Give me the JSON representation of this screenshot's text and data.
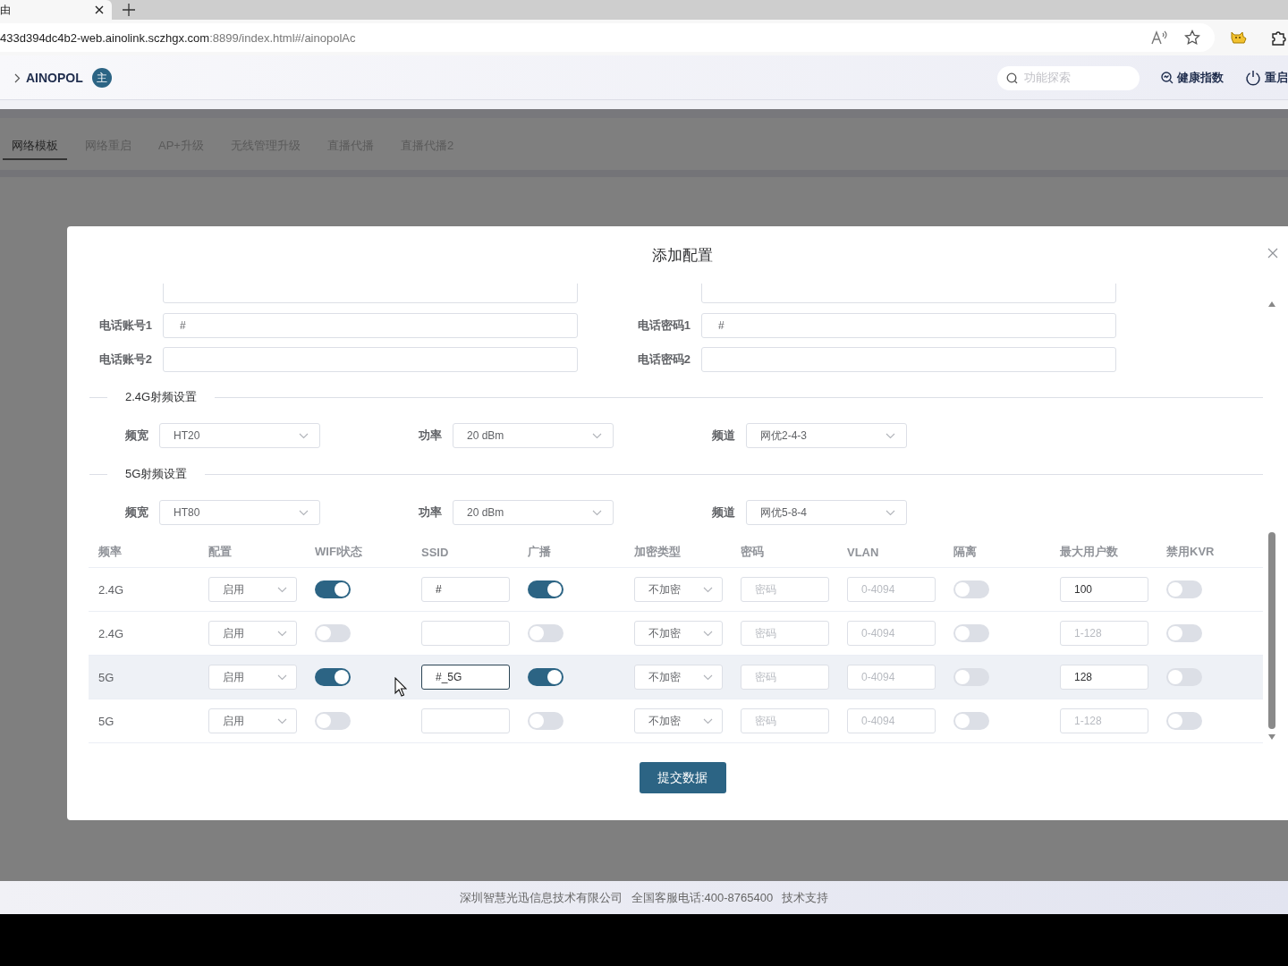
{
  "browser": {
    "tab_title": "由",
    "url_host": "433d394dc4b2-web.ainolink.sczhgx.com",
    "url_path": ":8899/index.html#/ainopolAc"
  },
  "header": {
    "breadcrumb": "AINOPOL",
    "badge": "主",
    "search": {
      "placeholder": "功能探索"
    },
    "actions": [
      {
        "kind": "health",
        "label": "健康指数"
      },
      {
        "kind": "power",
        "label": "重启"
      }
    ]
  },
  "tabs": [
    {
      "label": "网络模板",
      "selected": true
    },
    {
      "label": "网络重启",
      "selected": false
    },
    {
      "label": "AP+升级",
      "selected": false
    },
    {
      "label": "无线管理升级",
      "selected": false
    },
    {
      "label": "直播代播",
      "selected": false
    },
    {
      "label": "直播代播2",
      "selected": false
    }
  ],
  "modal": {
    "title": "添加配置",
    "fields": [
      [
        {
          "label": "电话账号1",
          "value": "#"
        },
        {
          "label": "电话密码1",
          "value": "#"
        }
      ],
      [
        {
          "label": "电话账号2"
        },
        {
          "label": "电话密码2"
        }
      ]
    ],
    "sections": [
      {
        "title": "2.4G射频设置",
        "selects": [
          {
            "label": "频宽",
            "value": "HT20"
          },
          {
            "label": "功率",
            "value": "20 dBm"
          },
          {
            "label": "频道",
            "value": "网优2-4-3"
          }
        ]
      },
      {
        "title": "5G射频设置",
        "selects": [
          {
            "label": "频宽",
            "value": "HT80"
          },
          {
            "label": "功率",
            "value": "20 dBm"
          },
          {
            "label": "频道",
            "value": "网优5-8-4"
          }
        ]
      }
    ],
    "table": {
      "columns": [
        {
          "label": "频率",
          "kind": "text"
        },
        {
          "label": "配置",
          "kind": "select"
        },
        {
          "label": "WIFI状态",
          "kind": "toggle"
        },
        {
          "label": "SSID",
          "kind": "input"
        },
        {
          "label": "广播",
          "kind": "toggle"
        },
        {
          "label": "加密类型",
          "kind": "select"
        },
        {
          "label": "密码",
          "kind": "input"
        },
        {
          "label": "VLAN",
          "kind": "input"
        },
        {
          "label": "隔离",
          "kind": "toggle"
        },
        {
          "label": "最大用户数",
          "kind": "input"
        },
        {
          "label": "禁用KVR",
          "kind": "toggle"
        }
      ],
      "rows": [
        {
          "highlighted": false,
          "cells": [
            "2.4G",
            "启用",
            true,
            {
              "value": "#",
              "focused": false
            },
            true,
            "不加密",
            {
              "placeholder": "密码",
              "focused": false
            },
            {
              "placeholder": "0-4094",
              "focused": false
            },
            false,
            {
              "value": "100",
              "focused": false
            },
            false
          ]
        },
        {
          "highlighted": false,
          "cells": [
            "2.4G",
            "启用",
            false,
            {
              "focused": false
            },
            false,
            "不加密",
            {
              "placeholder": "密码",
              "focused": false
            },
            {
              "placeholder": "0-4094",
              "focused": false
            },
            false,
            {
              "placeholder": "1-128",
              "focused": false
            },
            false
          ]
        },
        {
          "highlighted": true,
          "cells": [
            "5G",
            "启用",
            true,
            {
              "value": "#_5G",
              "focused": true
            },
            true,
            "不加密",
            {
              "placeholder": "密码",
              "focused": false
            },
            {
              "placeholder": "0-4094",
              "focused": false
            },
            false,
            {
              "value": "128",
              "focused": false
            },
            false
          ]
        },
        {
          "highlighted": false,
          "cells": [
            "5G",
            "启用",
            false,
            {
              "focused": false
            },
            false,
            "不加密",
            {
              "placeholder": "密码",
              "focused": false
            },
            {
              "placeholder": "0-4094",
              "focused": false
            },
            false,
            {
              "placeholder": "1-128",
              "focused": false
            },
            false
          ]
        }
      ]
    },
    "submit": "提交数据"
  },
  "footer": [
    "深圳智慧光迅信息技术有限公司",
    "全国客服电话:400-8765400",
    "技术支持"
  ]
}
